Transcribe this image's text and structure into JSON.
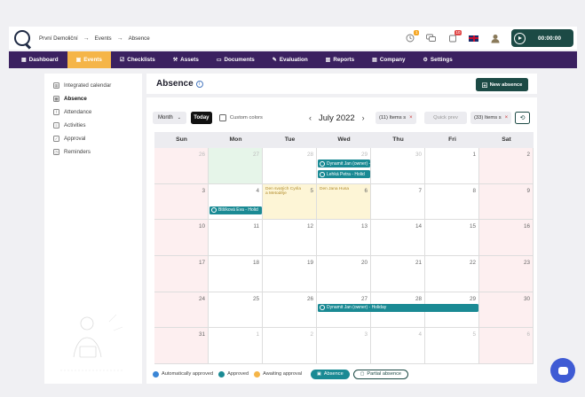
{
  "breadcrumb": [
    "První Demoliční",
    "Events",
    "Absence"
  ],
  "breadcrumb_sep": "→",
  "topbar": {
    "badges": {
      "clock": "1",
      "notification": "10"
    },
    "badge_colors": {
      "clock": "#f5a623",
      "notification": "#e04545"
    },
    "timer": "00:00:00"
  },
  "nav": [
    {
      "label": "Dashboard",
      "icon": "dashboard-icon"
    },
    {
      "label": "Events",
      "icon": "calendar-icon",
      "active": true
    },
    {
      "label": "Checklists",
      "icon": "checklist-icon"
    },
    {
      "label": "Assets",
      "icon": "tools-icon"
    },
    {
      "label": "Documents",
      "icon": "folder-icon"
    },
    {
      "label": "Evaluation",
      "icon": "evaluation-icon"
    },
    {
      "label": "Reports",
      "icon": "chart-icon"
    },
    {
      "label": "Company",
      "icon": "building-icon"
    },
    {
      "label": "Settings",
      "icon": "gear-icon"
    }
  ],
  "sidebar": [
    {
      "label": "Integrated calendar",
      "icon": "calendar-icon"
    },
    {
      "label": "Absence",
      "icon": "calendar-icon",
      "active": true
    },
    {
      "label": "Attendance",
      "icon": "attendance-icon"
    },
    {
      "label": "Activities",
      "icon": "activities-icon"
    },
    {
      "label": "Approval",
      "icon": "approval-icon"
    },
    {
      "label": "Reminders",
      "icon": "reminder-icon"
    }
  ],
  "main": {
    "title": "Absence",
    "new_button": "New absence"
  },
  "toolbar": {
    "view_select": "Month",
    "today": "Today",
    "custom_colors": "Custom colors",
    "month_label": "July 2022",
    "chip_items_1": "(11) Items s",
    "chip_quick": "Quick prev",
    "chip_items_2": "(33) Items s"
  },
  "calendar": {
    "weekdays": [
      "Sun",
      "Mon",
      "Tue",
      "Wed",
      "Thu",
      "Fri",
      "Sat"
    ],
    "weeks": [
      [
        {
          "d": "26",
          "o": true
        },
        {
          "d": "27",
          "o": true,
          "today": true
        },
        {
          "d": "28",
          "o": true
        },
        {
          "d": "29",
          "o": true
        },
        {
          "d": "30",
          "o": true
        },
        {
          "d": "1"
        },
        {
          "d": "2"
        }
      ],
      [
        {
          "d": "3"
        },
        {
          "d": "4"
        },
        {
          "d": "5",
          "hol": "Den svatých Cyrila a Metoděje"
        },
        {
          "d": "6",
          "hol": "Den Jana Husa"
        },
        {
          "d": "7"
        },
        {
          "d": "8"
        },
        {
          "d": "9"
        }
      ],
      [
        {
          "d": "10"
        },
        {
          "d": "11"
        },
        {
          "d": "12"
        },
        {
          "d": "13"
        },
        {
          "d": "14"
        },
        {
          "d": "15"
        },
        {
          "d": "16"
        }
      ],
      [
        {
          "d": "17"
        },
        {
          "d": "18"
        },
        {
          "d": "19"
        },
        {
          "d": "20"
        },
        {
          "d": "21"
        },
        {
          "d": "22"
        },
        {
          "d": "23"
        }
      ],
      [
        {
          "d": "24"
        },
        {
          "d": "25"
        },
        {
          "d": "26"
        },
        {
          "d": "27"
        },
        {
          "d": "28"
        },
        {
          "d": "29"
        },
        {
          "d": "30"
        }
      ],
      [
        {
          "d": "31"
        },
        {
          "d": "1",
          "o": true
        },
        {
          "d": "2",
          "o": true
        },
        {
          "d": "3",
          "o": true
        },
        {
          "d": "4",
          "o": true
        },
        {
          "d": "5",
          "o": true
        },
        {
          "d": "6",
          "o": true
        }
      ]
    ],
    "events": [
      {
        "label": "Dynamit Jan (owner) - Holi",
        "week": 0,
        "start": 3,
        "span": 1,
        "row": 0
      },
      {
        "label": "Lehká Petra - Holid",
        "week": 0,
        "start": 3,
        "span": 1,
        "row": 1
      },
      {
        "label": "Blšíková Eva - Holid",
        "week": 1,
        "start": 1,
        "span": 1,
        "row": 1
      },
      {
        "label": "Dynamit Jan (owner) - Holiday",
        "week": 4,
        "start": 3,
        "span": 3,
        "row": 0
      }
    ],
    "colors": {
      "event": "#1a8a94",
      "weekend": "#fdeff0",
      "today": "#e6f5e9",
      "holiday": "#fdf5d6"
    }
  },
  "legend": {
    "auto": "Automatically approved",
    "approved": "Approved",
    "awaiting": "Awaiting approval",
    "absence_btn": "Absence",
    "partial_btn": "Partial absence",
    "colors": {
      "auto": "#3b86d6",
      "approved": "#1a8a94",
      "awaiting": "#f5b548"
    }
  }
}
